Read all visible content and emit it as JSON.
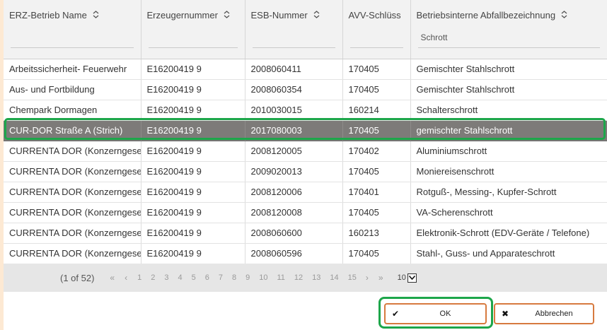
{
  "table": {
    "columns": [
      {
        "label": "ERZ-Betrieb Name",
        "sortable": true,
        "filter": ""
      },
      {
        "label": "Erzeugernummer",
        "sortable": true,
        "filter": ""
      },
      {
        "label": "ESB-Nummer",
        "sortable": true,
        "filter": ""
      },
      {
        "label": "AVV-Schlüss",
        "sortable": false,
        "filter": ""
      },
      {
        "label": "Betriebsinterne Abfallbezeichnung",
        "sortable": true,
        "filter": "Schrott"
      }
    ],
    "rows": [
      [
        "Arbeitssicherheit- Feuerwehr",
        "E16200419 9",
        "2008060411",
        "170405",
        "Gemischter Stahlschrott"
      ],
      [
        "Aus- und Fortbildung",
        "E16200419 9",
        "2008060354",
        "170405",
        "Gemischter Stahlschrott"
      ],
      [
        "Chempark Dormagen",
        "E16200419 9",
        "2010030015",
        "160214",
        "Schalterschrott"
      ],
      [
        "CUR-DOR Straße A (Strich)",
        "E16200419 9",
        "2017080003",
        "170405",
        "gemischter Stahlschrott"
      ],
      [
        "CURRENTA DOR (Konzerngesellschaft)",
        "E16200419 9",
        "2008120005",
        "170402",
        "Aluminiumschrott"
      ],
      [
        "CURRENTA DOR (Konzerngesellschaft)",
        "E16200419 9",
        "2009020013",
        "170405",
        "Moniereisenschrott"
      ],
      [
        "CURRENTA DOR (Konzerngesellschaft)",
        "E16200419 9",
        "2008120006",
        "170401",
        "Rotguß-, Messing-, Kupfer-Schrott"
      ],
      [
        "CURRENTA DOR (Konzerngesellschaft)",
        "E16200419 9",
        "2008120008",
        "170405",
        "VA-Scherenschrott"
      ],
      [
        "CURRENTA DOR (Konzerngesellschaft)",
        "E16200419 9",
        "2008060600",
        "160213",
        "Elektronik-Schrott (EDV-Geräte / Telefone)"
      ],
      [
        "CURRENTA DOR (Konzerngesellschaft)",
        "E16200419 9",
        "2008060596",
        "170405",
        "Stahl-, Guss- und Apparateschrott"
      ]
    ],
    "selected_row": 3
  },
  "pager": {
    "count": "(1 of 52)",
    "first": "«",
    "prev": "‹",
    "pages": [
      "1",
      "2",
      "3",
      "4",
      "5",
      "6",
      "7",
      "8",
      "9",
      "10",
      "11",
      "12",
      "13",
      "14",
      "15"
    ],
    "next": "›",
    "last": "»",
    "rows_per_page": "10"
  },
  "buttons": {
    "ok_label": "OK",
    "cancel_label": "Abbrechen"
  },
  "icons": {
    "sort": "sort-icon",
    "ok": "check-icon",
    "cancel": "x-icon",
    "dropdown": "chevron-down-icon"
  },
  "colors": {
    "selected_row": "#7d7b79",
    "highlight": "#1da64a",
    "button_border": "#d77a3f"
  }
}
